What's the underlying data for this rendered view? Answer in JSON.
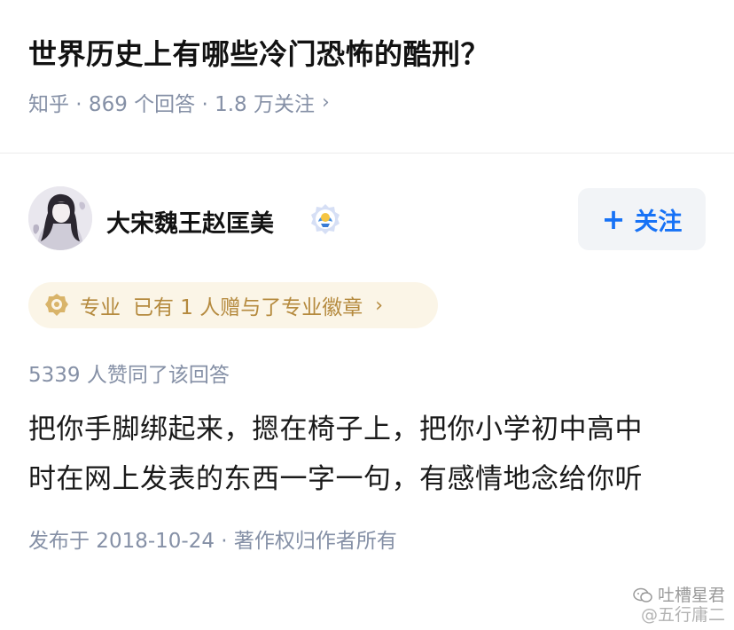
{
  "question": {
    "title": "世界历史上有哪些冷门恐怖的酷刑？",
    "meta": "知乎 · 869 个回答 · 1.8 万关注",
    "meta_chevron": "›"
  },
  "author": {
    "name": "大宋魏王赵匡美",
    "avatar_icon": "avatar-image",
    "badge_icon": "verified-badge-icon",
    "follow_plus": "+",
    "follow_label": "关注"
  },
  "pro_badge": {
    "icon": "medal-icon",
    "label": "专业",
    "text": "已有 1 人赠与了专业徽章",
    "chevron": "›"
  },
  "answer": {
    "upvotes": "5339 人赞同了该回答",
    "lines": [
      "把你手脚绑起来，摁在椅子上，把你小学初中高中",
      "时在网上发表的东西一字一句，有感情地念给你听"
    ],
    "publish_info": "发布于 2018-10-24 · 著作权归作者所有"
  },
  "watermark": {
    "line1": "吐槽星君",
    "line2": "@五行庸二"
  },
  "colors": {
    "primary_blue": "#1772f6",
    "meta_gray": "#8590a6",
    "pro_gold": "#b58a3e",
    "pro_bg": "#fbf5e7",
    "follow_bg": "#f2f4f7"
  }
}
